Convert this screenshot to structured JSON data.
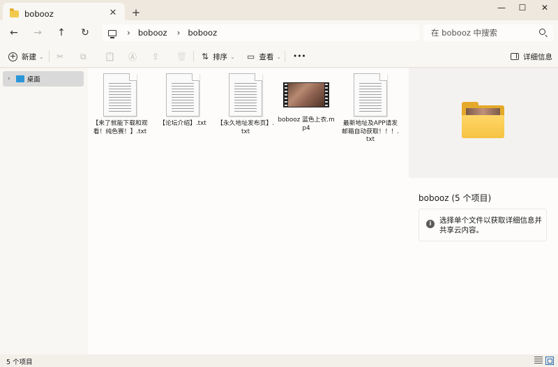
{
  "window": {
    "tab_title": "bobooz",
    "tab_close": "✕",
    "new_tab": "+",
    "minimize": "—",
    "maximize": "☐",
    "close": "✕"
  },
  "address": {
    "back": "←",
    "forward": "→",
    "up": "↑",
    "refresh": "↻",
    "separator": "›",
    "crumbs": [
      "bobooz",
      "bobooz"
    ],
    "search_placeholder": "在 bobooz 中搜索"
  },
  "commands": {
    "new": "新建",
    "sort": "排序",
    "view": "查看",
    "more": "•••",
    "details": "详细信息",
    "cut_icon": "✂",
    "copy_icon": "⧉",
    "paste_icon": "📋",
    "rename_icon": "Ⓐ",
    "share_icon": "⇪",
    "delete_icon": "🗑",
    "sort_icon": "⇅",
    "view_icon": "▭",
    "dropdown": "⌄"
  },
  "nav": {
    "items": [
      {
        "label": "桌面",
        "chevron": "›"
      }
    ]
  },
  "files": [
    {
      "name": "【来了就能下载和观看！纯色赛！】.txt",
      "type": "document-icon"
    },
    {
      "name": "【论坛介绍】.txt",
      "type": "document-icon"
    },
    {
      "name": "【永久地址发布页】.txt",
      "type": "document-icon"
    },
    {
      "name": "bobooz 蓝色上衣.mp4",
      "type": "video-thumbnail"
    },
    {
      "name": "最新地址及APP请发邮箱自动获取！！！.txt",
      "type": "document-icon"
    }
  ],
  "details_pane": {
    "title": "bobooz (5 个项目)",
    "info_icon": "i",
    "info_text": "选择单个文件以获取详细信息并共享云内容。"
  },
  "status": {
    "count": "5 个项目"
  },
  "colors": {
    "accent": "#2b6cb0",
    "folder": "#f6c343",
    "selection": "#d9d9d9"
  }
}
